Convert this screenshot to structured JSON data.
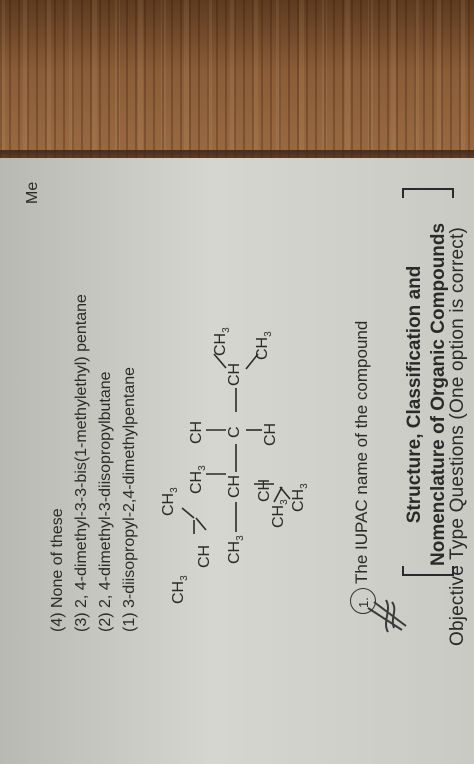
{
  "heading": "Objective Type Questions (One option is correct)",
  "section_line1": "Structure, Classification and",
  "section_line2": "Nomenclature of Organic Compounds",
  "question_number": "1.",
  "question_text": "The IUPAC name of the compound",
  "structure": {
    "ch3": "CH",
    "sub3": "3",
    "ch": "CH",
    "c": "C"
  },
  "options": [
    "(1)  3-diisopropyl-2,4-dimethylpentane",
    "(2)  2, 4-dimethyl-3-diisopropylbutane",
    "(3)  2, 4-dimethyl-3-3-bis(1-methylethyl) pentane",
    "(4)  None of these"
  ],
  "side_note": "Me"
}
